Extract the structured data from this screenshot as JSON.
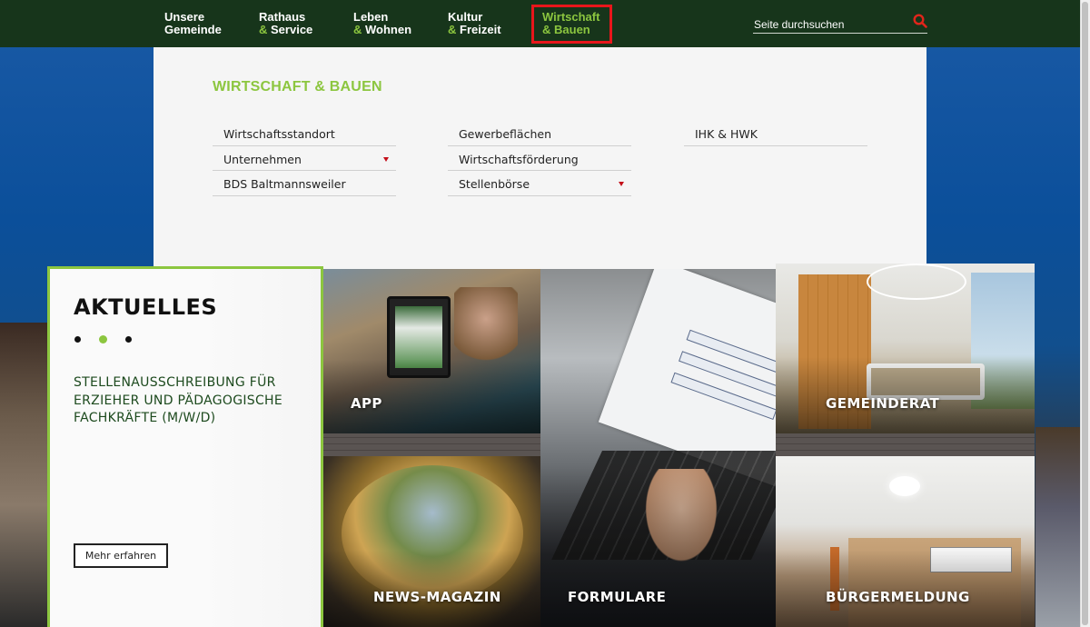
{
  "nav": {
    "items": [
      {
        "line1": "Unsere",
        "line2": "Gemeinde"
      },
      {
        "line1": "Rathaus",
        "amp": "&",
        "line2": "Service"
      },
      {
        "line1": "Leben",
        "amp": "&",
        "line2": "Wohnen"
      },
      {
        "line1": "Kultur",
        "amp": "&",
        "line2": "Freizeit"
      },
      {
        "line1": "Wirtschaft",
        "amp": "&",
        "line2": "Bauen"
      }
    ],
    "search_placeholder": "Seite durchsuchen"
  },
  "mega_menu": {
    "title": "WIRTSCHAFT & BAUEN",
    "columns": [
      [
        {
          "label": "Wirtschaftsstandort",
          "has_children": false
        },
        {
          "label": "Unternehmen",
          "has_children": true
        },
        {
          "label": "BDS Baltmannsweiler",
          "has_children": false
        }
      ],
      [
        {
          "label": "Gewerbeflächen",
          "has_children": false
        },
        {
          "label": "Wirtschaftsförderung",
          "has_children": false
        },
        {
          "label": "Stellenbörse",
          "has_children": true
        }
      ],
      [
        {
          "label": "IHK & HWK",
          "has_children": false
        }
      ]
    ]
  },
  "news": {
    "title": "AKTUELLES",
    "headline": "STELLENAUSSCHREIBUNG FÜR ERZIEHER UND PÄDAGOGISCHE FACHKRÄFTE (M/W/D)",
    "button": "Mehr erfahren",
    "slides": 3,
    "active_slide": 2
  },
  "tiles": {
    "app": "APP",
    "gemeinderat": "GEMEINDERAT",
    "news_magazin": "NEWS-MAGAZIN",
    "formulare": "FORMULARE",
    "buergermeldung": "BÜRGERMELDUNG"
  },
  "colors": {
    "topbar": "#17351b",
    "accent_green": "#8cc63f",
    "highlight_red": "#e8161b",
    "caret_red": "#c40f1a",
    "menu_bg": "#f5f5f5"
  },
  "icons": {
    "search": "search-icon",
    "submenu": "caret-down-icon"
  }
}
